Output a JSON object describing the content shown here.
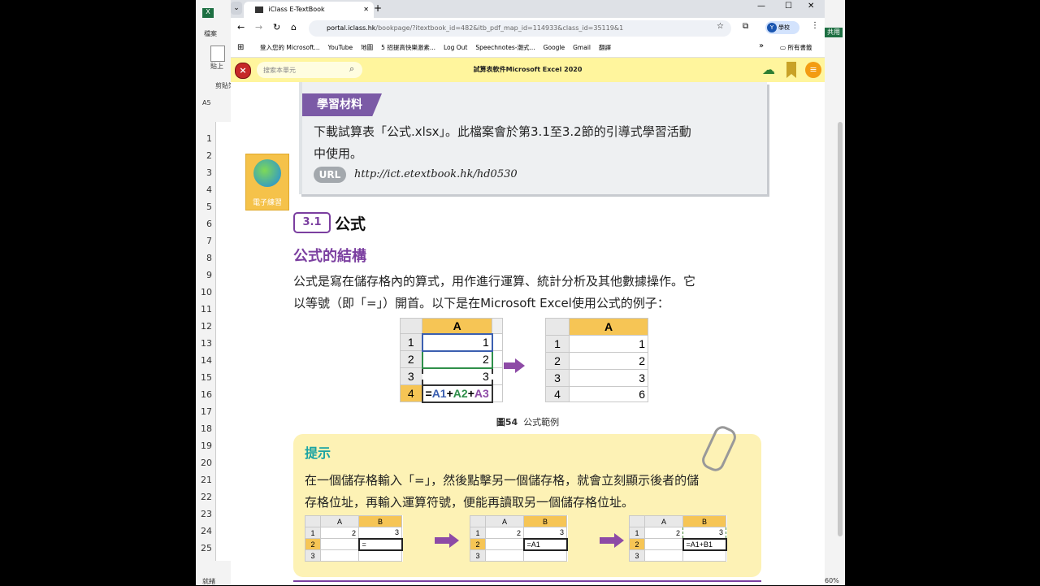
{
  "excel": {
    "ribbon_tab": "檔案",
    "paste_label": "貼上",
    "clipboard_label": "剪貼簿",
    "name_box": "A5",
    "row_numbers": [
      "1",
      "2",
      "3",
      "4",
      "5",
      "6",
      "7",
      "8",
      "9",
      "10",
      "11",
      "12",
      "13",
      "14",
      "15",
      "16",
      "17",
      "18",
      "19",
      "20",
      "21",
      "22",
      "23",
      "24",
      "25"
    ],
    "status_left": "就緒",
    "zoom": "60%",
    "right_badge": "共用"
  },
  "browser": {
    "tab_title": "iClass E-TextBook",
    "new_tab": "+",
    "url_host": "portal.iclass.hk",
    "url_path": "/bookpage/?itextbook_id=482&itb_pdf_map_id=114933&class_id=35119&1",
    "profile_label": "學校",
    "profile_initial": "Y",
    "bookmarks": [
      "登入您的 Microsoft...",
      "YouTube",
      "地圖",
      "5 招提高快樂激素...",
      "Log Out",
      "Speechnotes-潮式...",
      "Google",
      "Gmail",
      "翻譯"
    ],
    "bookmarks_more": "»",
    "all_bookmarks": "所有書籤"
  },
  "ebook": {
    "search_placeholder": "搜索本單元",
    "title": "試算表軟件Microsoft Excel 2020"
  },
  "content": {
    "material_tag": "學習材料",
    "material_text_1": "下載試算表「公式.xlsx」。此檔案會於第3.1至3.2節的引導式學習活動",
    "material_text_2": "中使用。",
    "url_badge": "URL",
    "url_text": "http://ict.etextbook.hk/hd0530",
    "side_icon_label": "電子練習",
    "section_num": "3.1",
    "section_title": "公式",
    "sub_heading": "公式的結構",
    "para_1": "公式是寫在儲存格內的算式，用作進行運算、統計分析及其他數據操作。它",
    "para_2": "以等號（即「=」）開首。以下是在Microsoft Excel使用公式的例子：",
    "fig_left": {
      "col": "A",
      "rows": [
        "1",
        "2",
        "3",
        "4"
      ],
      "values": [
        "1",
        "2",
        "3"
      ],
      "formula": {
        "eq": "=",
        "a1": "A1",
        "p1": "+",
        "a2": "A2",
        "p2": "+",
        "a3": "A3"
      }
    },
    "fig_right": {
      "col": "A",
      "rows": [
        "1",
        "2",
        "3",
        "4"
      ],
      "values": [
        "1",
        "2",
        "3",
        "6"
      ]
    },
    "fig_caption_num": "圖54",
    "fig_caption_text": "公式範例",
    "hint_title": "提示",
    "hint_1": "在一個儲存格輸入「=」，然後點擊另一個儲存格，就會立刻顯示後者的儲",
    "hint_2": "存格位址，再輸入運算符號，便能再讀取另一個儲存格位址。",
    "mini": [
      {
        "cols": [
          "A",
          "B"
        ],
        "rows": [
          "1",
          "2",
          "3"
        ],
        "r1": [
          "2",
          "3"
        ],
        "r2": "="
      },
      {
        "cols": [
          "A",
          "B"
        ],
        "rows": [
          "1",
          "2",
          "3"
        ],
        "r1": [
          "2",
          "3"
        ],
        "r2": "=A1"
      },
      {
        "cols": [
          "A",
          "B"
        ],
        "rows": [
          "1",
          "2",
          "3"
        ],
        "r1": [
          "2",
          "3"
        ],
        "r2": "=A1+B1"
      }
    ]
  }
}
